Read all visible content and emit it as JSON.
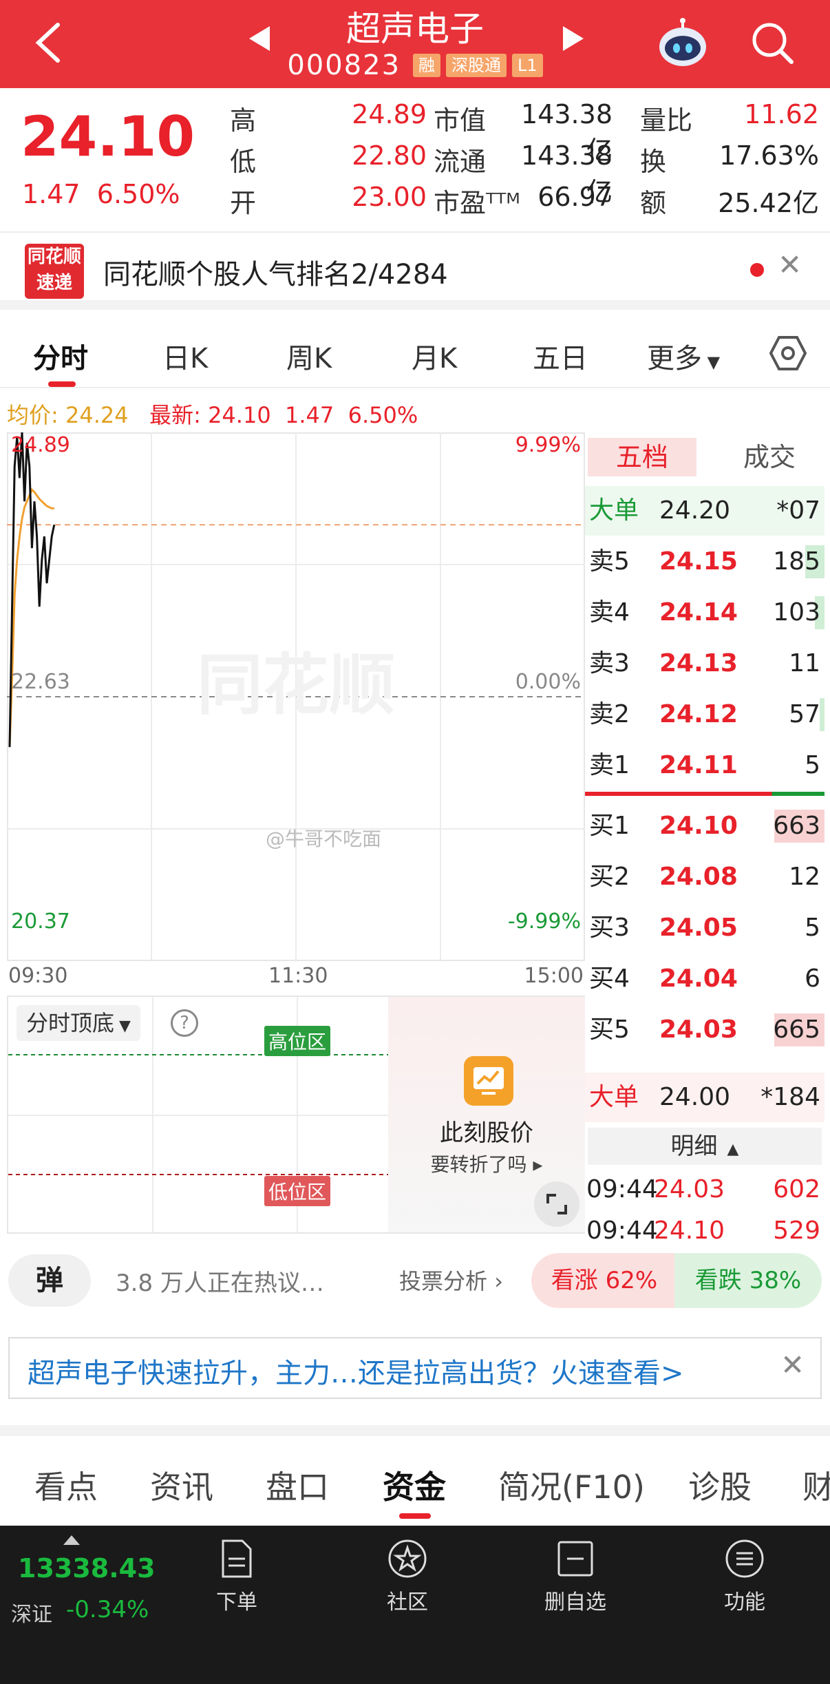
{
  "header": {
    "title": "超声电子",
    "code": "000823",
    "tags": [
      "融",
      "深股通",
      "L1"
    ]
  },
  "quote": {
    "price": "24.10",
    "change": "1.47",
    "change_pct": "6.50%",
    "rows": [
      [
        {
          "label": "高",
          "value": "24.89"
        },
        {
          "label": "市值",
          "value": "143.38亿"
        },
        {
          "label": "量比",
          "value": "11.62"
        }
      ],
      [
        {
          "label": "低",
          "value": "22.80"
        },
        {
          "label": "流通",
          "value": "143.38亿"
        },
        {
          "label": "换",
          "value": "17.63%"
        }
      ],
      [
        {
          "label": "开",
          "value": "23.00"
        },
        {
          "label": "市盈ᵀᵀᴹ",
          "value": "66.97"
        },
        {
          "label": "额",
          "value": "25.42亿"
        }
      ]
    ]
  },
  "banner": {
    "logo_top": "同花顺",
    "logo_bottom": "速递",
    "text": "同花顺个股人气排名2/4284"
  },
  "tabs": [
    "分时",
    "日K",
    "周K",
    "月K",
    "五日",
    "更多"
  ],
  "summary": {
    "avg_label": "均价:",
    "avg_value": "24.24",
    "latest_label": "最新:",
    "latest_value": "24.10",
    "latest_change": "1.47",
    "latest_pct": "6.50%"
  },
  "chart": {
    "high_label": "24.89",
    "mid_label": "22.63",
    "low_label": "20.37",
    "high_pct": "9.99%",
    "mid_pct": "0.00%",
    "low_pct": "-9.99%",
    "watermark": "同花顺",
    "social_watermark": "@牛哥不吃面",
    "x_ticks": [
      "09:30",
      "11:30",
      "15:00"
    ]
  },
  "chart_data": {
    "type": "line",
    "title": "",
    "y_range": [
      20.37,
      24.89
    ],
    "prev_close": 22.63,
    "series": [
      {
        "values": [
          22.2,
          23.4,
          24.6,
          24.85,
          24.5,
          24.89,
          24.3,
          24.8,
          24.6,
          23.9,
          24.3,
          24.0,
          23.4,
          23.8,
          24.0,
          23.6,
          23.8,
          24.0,
          24.1
        ]
      },
      {
        "values": [
          22.2,
          22.8,
          23.5,
          23.8,
          24.0,
          24.15,
          24.25,
          24.3,
          24.35,
          24.4,
          24.38,
          24.35,
          24.32,
          24.3,
          24.28,
          24.26,
          24.25,
          24.24,
          24.24
        ]
      }
    ]
  },
  "indicator": {
    "select_label": "分时顶底",
    "high_zone": "高位区",
    "low_zone": "低位区",
    "card_title": "此刻股价",
    "card_sub": "要转折了吗 ▸"
  },
  "book": {
    "tab_active": "五档",
    "tab_other": "成交",
    "big_sell": {
      "label": "大单",
      "price": "24.20",
      "vol": "*07"
    },
    "asks": [
      {
        "label": "卖5",
        "price": "24.15",
        "vol": "185",
        "bar": 0.08
      },
      {
        "label": "卖4",
        "price": "24.14",
        "vol": "103",
        "bar": 0.04
      },
      {
        "label": "卖3",
        "price": "24.13",
        "vol": "11",
        "bar": 0.0
      },
      {
        "label": "卖2",
        "price": "24.12",
        "vol": "57",
        "bar": 0.02
      },
      {
        "label": "卖1",
        "price": "24.11",
        "vol": "5",
        "bar": 0.0
      }
    ],
    "bids": [
      {
        "label": "买1",
        "price": "24.10",
        "vol": "663",
        "bar": 0.21
      },
      {
        "label": "买2",
        "price": "24.08",
        "vol": "12",
        "bar": 0.0
      },
      {
        "label": "买3",
        "price": "24.05",
        "vol": "5",
        "bar": 0.0
      },
      {
        "label": "买4",
        "price": "24.04",
        "vol": "6",
        "bar": 0.0
      },
      {
        "label": "买5",
        "price": "24.03",
        "vol": "665",
        "bar": 0.21
      }
    ],
    "big_buy": {
      "label": "大单",
      "price": "24.00",
      "vol": "*184"
    },
    "detail_label": "明细",
    "ticks": [
      {
        "time": "09:44",
        "price": "24.03",
        "vol": "602"
      },
      {
        "time": "09:44",
        "price": "24.10",
        "vol": "529"
      }
    ]
  },
  "sentiment": {
    "tan_label": "弹",
    "hot_text": "3.8 万人正在热议…",
    "vote_link": "投票分析",
    "bull": "看涨 62%",
    "bear": "看跌 38%"
  },
  "alert": {
    "text": "超声电子快速拉升，主力…还是拉高出货？火速查看>"
  },
  "bottom_tabs": [
    "看点",
    "资讯",
    "盘口",
    "资金",
    "简况(F10)",
    "诊股",
    "财"
  ],
  "footer": {
    "index_value": "13338.43",
    "index_name": "深证",
    "index_change": "-0.34%",
    "items": [
      "下单",
      "社区",
      "删自选",
      "功能"
    ]
  },
  "colors": {
    "brand_red": "#e8333a",
    "up_red": "#e8212a",
    "down_green": "#1a9a36",
    "avg_line": "#f0a030"
  }
}
